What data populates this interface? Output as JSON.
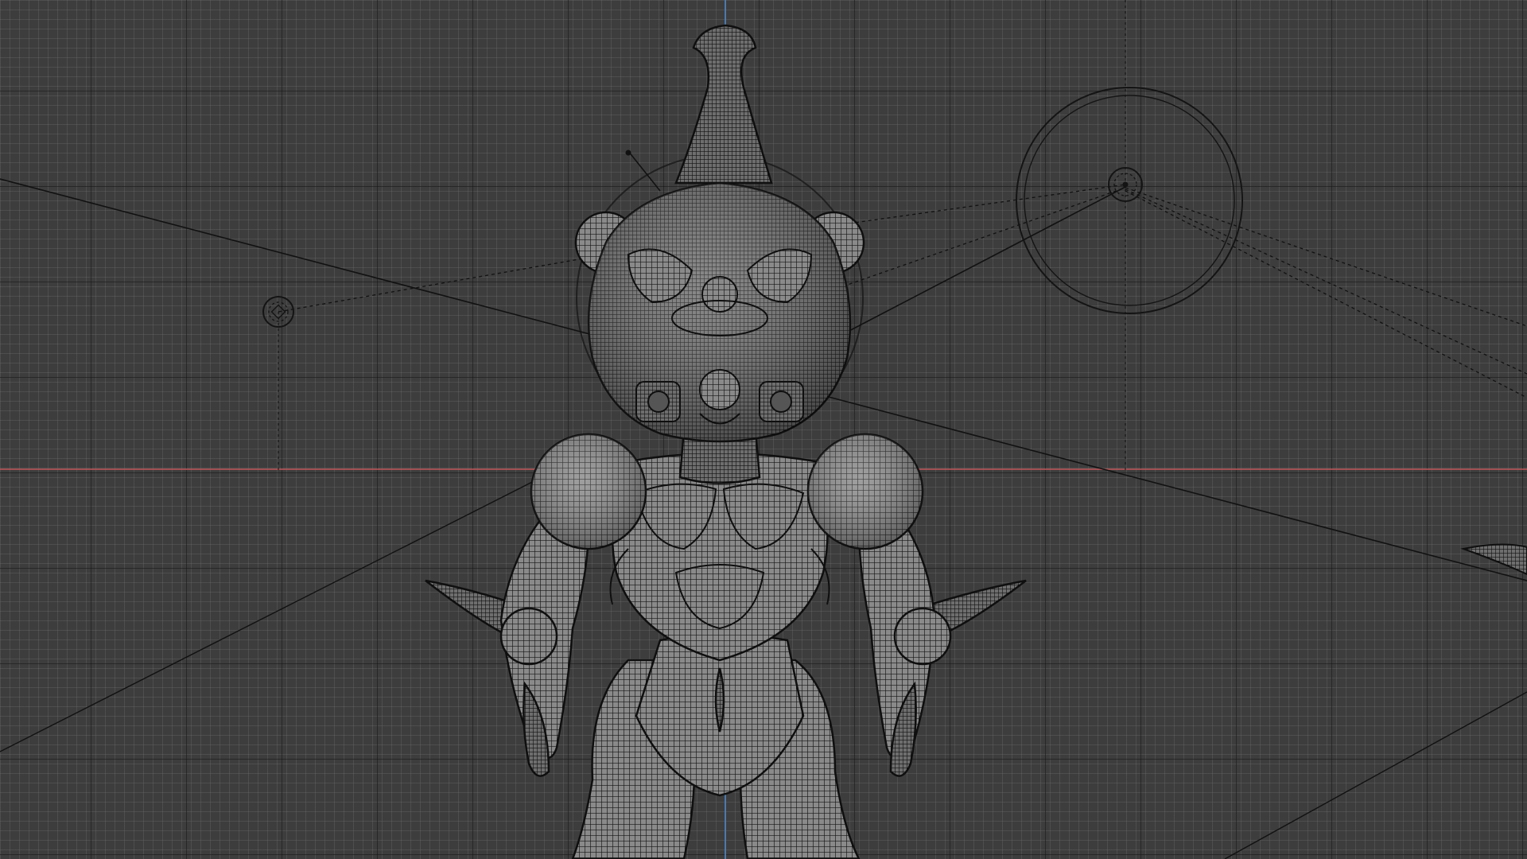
{
  "viewport": {
    "mode": "wireframe",
    "background": "#3d3d3d",
    "axis_x_color": "#c0565a",
    "axis_z_color": "#4f86c6"
  },
  "scene_objects": [
    {
      "name": "character-mesh",
      "type": "mesh"
    },
    {
      "name": "area-light",
      "type": "light"
    },
    {
      "name": "point-light",
      "type": "light"
    },
    {
      "name": "claw-mesh",
      "type": "mesh"
    }
  ]
}
